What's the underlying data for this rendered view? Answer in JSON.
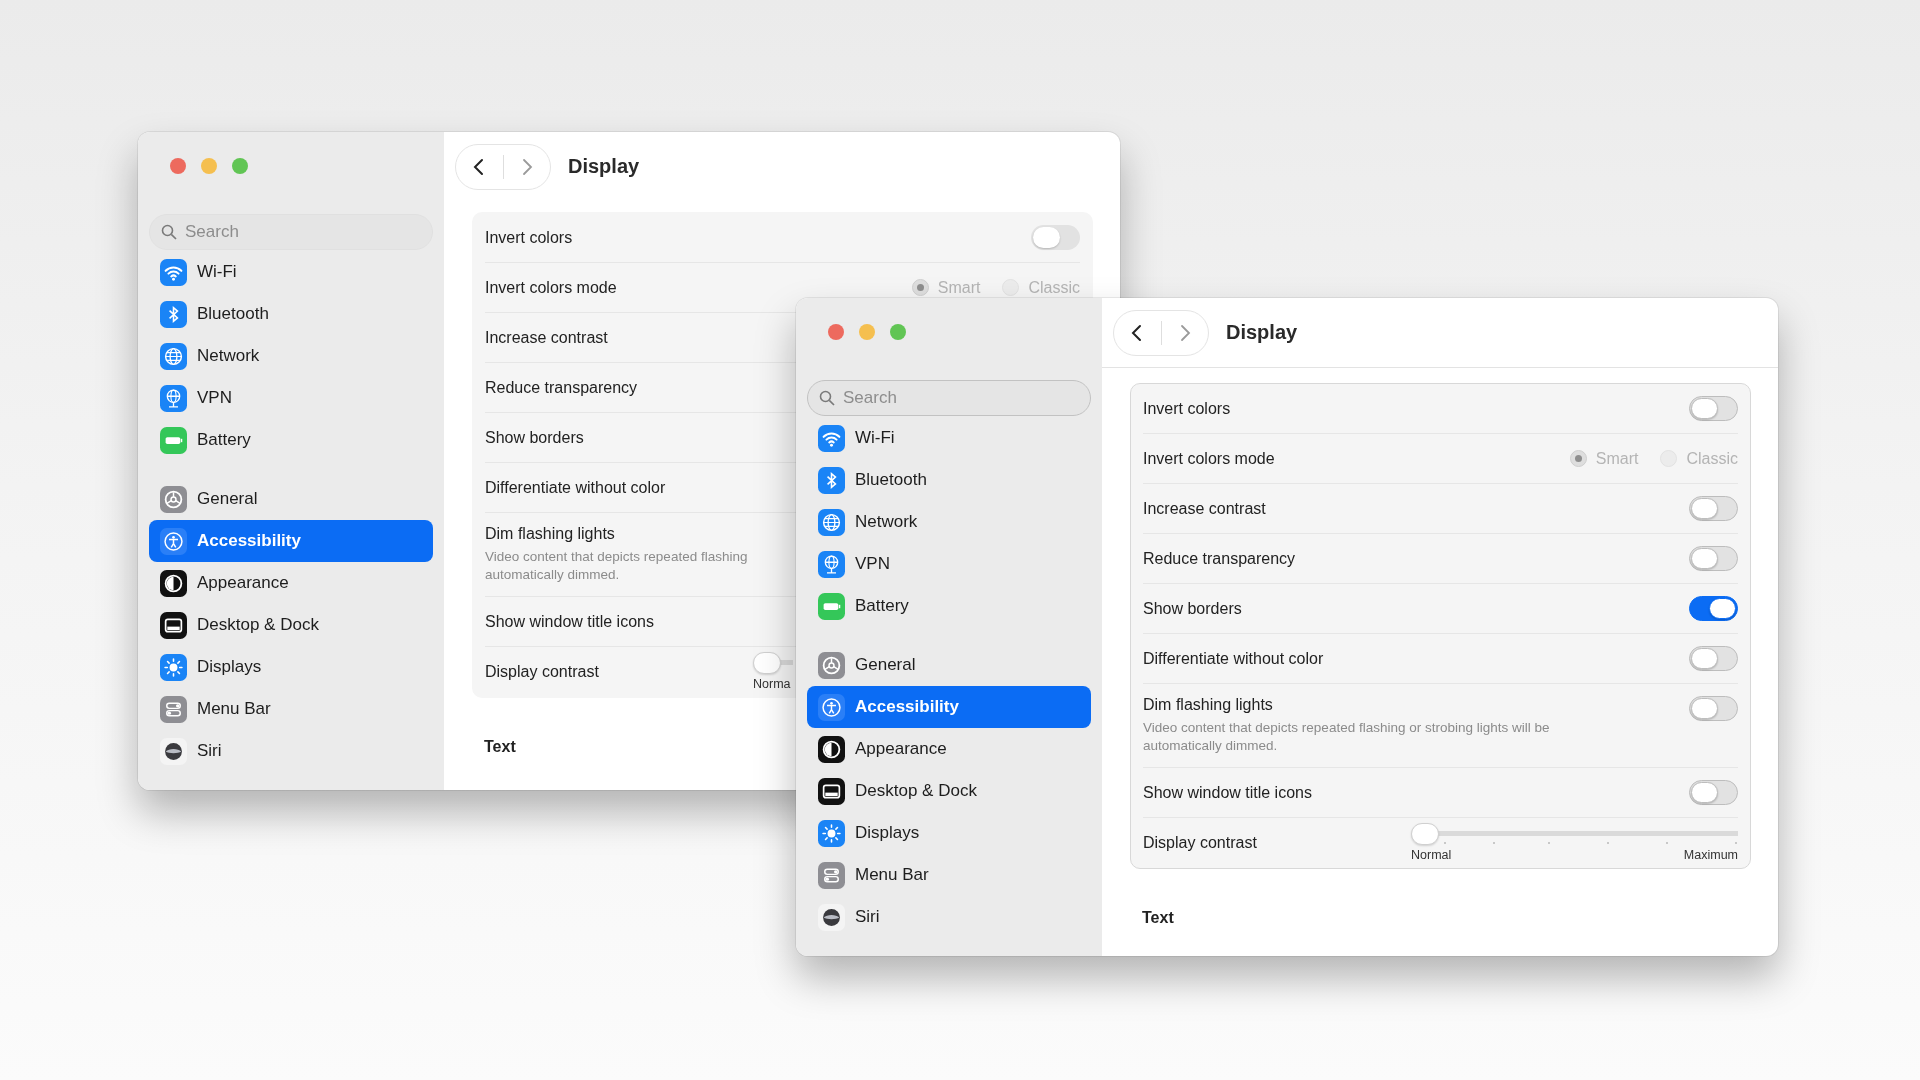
{
  "windows": [
    {
      "title": "Display",
      "show_borders": false,
      "sidebar": {
        "search": {
          "placeholder": "Search"
        },
        "groups": [
          [
            {
              "label": "Wi-Fi",
              "selected": false
            },
            {
              "label": "Bluetooth",
              "selected": false
            },
            {
              "label": "Network",
              "selected": false
            },
            {
              "label": "VPN",
              "selected": false
            },
            {
              "label": "Battery",
              "selected": false
            }
          ],
          [
            {
              "label": "General",
              "selected": false
            },
            {
              "label": "Accessibility",
              "selected": true
            },
            {
              "label": "Appearance",
              "selected": false
            },
            {
              "label": "Desktop & Dock",
              "selected": false
            },
            {
              "label": "Displays",
              "selected": false
            },
            {
              "label": "Menu Bar",
              "selected": false
            },
            {
              "label": "Siri",
              "selected": false
            }
          ]
        ]
      },
      "rows": [
        {
          "kind": "toggle",
          "label": "Invert colors",
          "on": false
        },
        {
          "kind": "radio",
          "label": "Invert colors mode",
          "disabled": true,
          "options": [
            {
              "label": "Smart",
              "selected": true
            },
            {
              "label": "Classic",
              "selected": false
            }
          ]
        },
        {
          "kind": "plain",
          "label": "Increase contrast"
        },
        {
          "kind": "plain",
          "label": "Reduce transparency"
        },
        {
          "kind": "plain",
          "label": "Show borders"
        },
        {
          "kind": "plain",
          "label": "Differentiate without color"
        },
        {
          "kind": "plain",
          "label": "Dim flashing lights",
          "description_lines": [
            "Video content that depicts repeated flashing",
            "automatically dimmed."
          ]
        },
        {
          "kind": "plain",
          "label": "Show window title icons"
        },
        {
          "kind": "slider",
          "label": "Display contrast",
          "level": 0,
          "min_label": "Norma"
        }
      ],
      "section_heading": "Text"
    },
    {
      "title": "Display",
      "show_borders": true,
      "sidebar": {
        "search": {
          "placeholder": "Search"
        },
        "groups": [
          [
            {
              "label": "Wi-Fi",
              "selected": false
            },
            {
              "label": "Bluetooth",
              "selected": false
            },
            {
              "label": "Network",
              "selected": false
            },
            {
              "label": "VPN",
              "selected": false
            },
            {
              "label": "Battery",
              "selected": false
            }
          ],
          [
            {
              "label": "General",
              "selected": false
            },
            {
              "label": "Accessibility",
              "selected": true
            },
            {
              "label": "Appearance",
              "selected": false
            },
            {
              "label": "Desktop & Dock",
              "selected": false
            },
            {
              "label": "Displays",
              "selected": false
            },
            {
              "label": "Menu Bar",
              "selected": false
            },
            {
              "label": "Siri",
              "selected": false
            }
          ]
        ]
      },
      "rows": [
        {
          "kind": "toggle",
          "label": "Invert colors",
          "on": false
        },
        {
          "kind": "radio",
          "label": "Invert colors mode",
          "disabled": true,
          "options": [
            {
              "label": "Smart",
              "selected": true
            },
            {
              "label": "Classic",
              "selected": false
            }
          ]
        },
        {
          "kind": "toggle",
          "label": "Increase contrast",
          "on": false
        },
        {
          "kind": "toggle",
          "label": "Reduce transparency",
          "on": false
        },
        {
          "kind": "toggle",
          "label": "Show borders",
          "on": true
        },
        {
          "kind": "toggle",
          "label": "Differentiate without color",
          "on": false
        },
        {
          "kind": "toggle",
          "label": "Dim flashing lights",
          "on": false,
          "description_lines": [
            "Video content that depicts repeated flashing or strobing lights will be",
            "automatically dimmed."
          ]
        },
        {
          "kind": "toggle",
          "label": "Show window title icons",
          "on": false
        },
        {
          "kind": "slider",
          "label": "Display contrast",
          "level": 0,
          "min_label": "Normal",
          "max_label": "Maximum"
        }
      ],
      "section_heading": "Text"
    }
  ]
}
